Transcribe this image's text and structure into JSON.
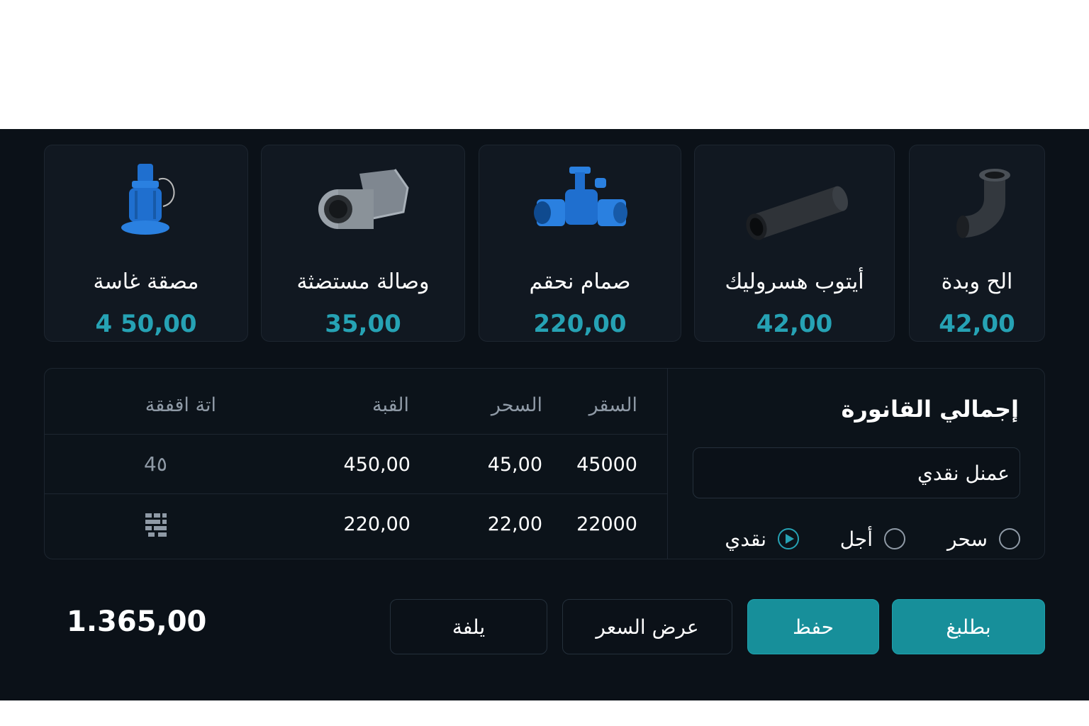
{
  "products": [
    {
      "name": "مصقة غاسة",
      "price": "4 50,00",
      "icon": "blue-nozzle"
    },
    {
      "name": "وصالة مستضثة",
      "price": "35,00",
      "icon": "steel-coupling"
    },
    {
      "name": "صمام نحقم",
      "price": "220,00",
      "icon": "blue-valve"
    },
    {
      "name": "أيتوب هسروليك",
      "price": "42,00",
      "icon": "black-pipe"
    },
    {
      "name": "الح وبدة",
      "price": "42,00",
      "icon": "pipe-elbow"
    }
  ],
  "invoice": {
    "columns": {
      "price": "السقر",
      "quantity": "السحر",
      "total": "القبة",
      "actions": "اتة اقفقة"
    },
    "rows": [
      {
        "price": "45000",
        "quantity": "45,00",
        "total": "450,00",
        "action": "4٥"
      },
      {
        "price": "22000",
        "quantity": "22,00",
        "total": "220,00",
        "action": "grid-icon"
      }
    ]
  },
  "summary": {
    "title": "إجمالي القانورة",
    "customer_value": "عمنل نقدي",
    "payment_options": [
      {
        "label": "سحر",
        "selected": false
      },
      {
        "label": "أجل",
        "selected": false
      },
      {
        "label": "نقدي",
        "selected": true
      }
    ]
  },
  "footer": {
    "total": "1.365,00",
    "btn_cancel": "يلفة",
    "btn_quote": "عرض السعر",
    "btn_save": "حفظ",
    "btn_print": "بطلبغ"
  },
  "colors": {
    "accent": "#26a2b4",
    "button": "#178f9a",
    "background": "#0b1118"
  }
}
